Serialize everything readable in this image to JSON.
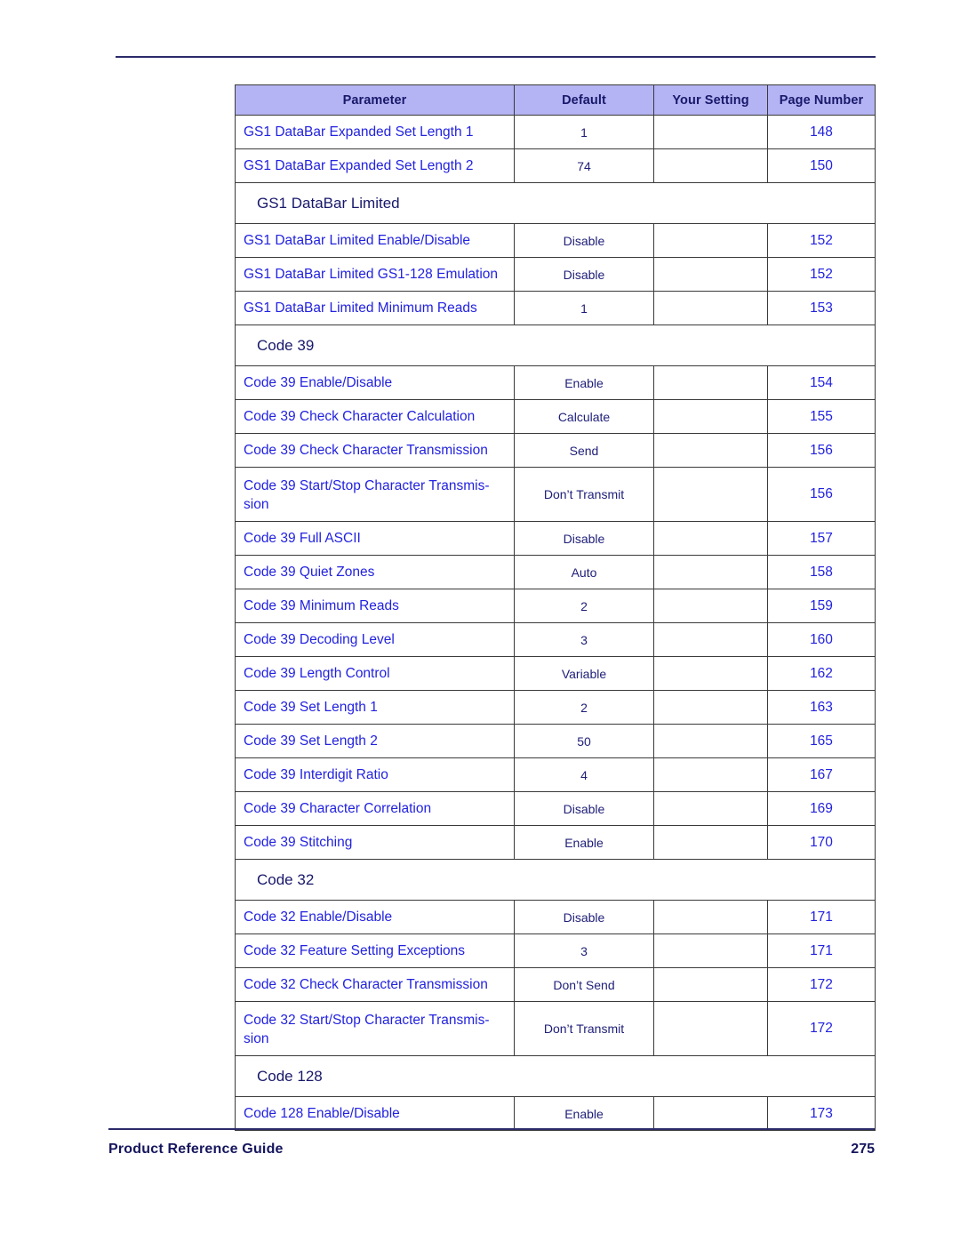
{
  "document": {
    "footer_left": "Product Reference Guide",
    "footer_page_number": "275"
  },
  "table": {
    "columns": [
      "Parameter",
      "Default",
      "Your Setting",
      "Page Number"
    ],
    "rows": [
      {
        "kind": "data",
        "parameter": "GS1 DataBar Expanded Set Length 1",
        "default": "1",
        "setting": "",
        "page": "148"
      },
      {
        "kind": "data",
        "parameter": "GS1 DataBar Expanded Set Length 2",
        "default": "74",
        "setting": "",
        "page": "150"
      },
      {
        "kind": "section",
        "title": "GS1 DataBar Limited"
      },
      {
        "kind": "data",
        "parameter": "GS1 DataBar Limited Enable/Disable",
        "default": "Disable",
        "setting": "",
        "page": "152"
      },
      {
        "kind": "data",
        "parameter": "GS1 DataBar Limited GS1-128 Emulation",
        "default": "Disable",
        "setting": "",
        "page": "152"
      },
      {
        "kind": "data",
        "parameter": "GS1 DataBar Limited Minimum Reads",
        "default": "1",
        "setting": "",
        "page": "153"
      },
      {
        "kind": "section",
        "title": "Code 39"
      },
      {
        "kind": "data",
        "parameter": "Code 39 Enable/Disable",
        "default": "Enable",
        "setting": "",
        "page": "154"
      },
      {
        "kind": "data",
        "parameter": "Code 39 Check Character Calculation",
        "default": "Calculate",
        "setting": "",
        "page": "155"
      },
      {
        "kind": "data",
        "parameter": "Code 39 Check Character Transmission",
        "default": "Send",
        "setting": "",
        "page": "156"
      },
      {
        "kind": "data",
        "two_line": true,
        "parameter": "Code 39 Start/Stop Character Transmis-\nsion",
        "default": "Don’t Transmit",
        "setting": "",
        "page": "156"
      },
      {
        "kind": "data",
        "parameter": "Code 39 Full ASCII",
        "default": "Disable",
        "setting": "",
        "page": "157"
      },
      {
        "kind": "data",
        "parameter": "Code 39 Quiet Zones",
        "default": "Auto",
        "setting": "",
        "page": "158"
      },
      {
        "kind": "data",
        "parameter": "Code 39 Minimum Reads",
        "default": "2",
        "setting": "",
        "page": "159"
      },
      {
        "kind": "data",
        "parameter": "Code 39 Decoding Level",
        "default": "3",
        "setting": "",
        "page": "160"
      },
      {
        "kind": "data",
        "parameter": "Code 39 Length Control",
        "default": "Variable",
        "setting": "",
        "page": "162"
      },
      {
        "kind": "data",
        "parameter": "Code 39 Set Length 1",
        "default": "2",
        "setting": "",
        "page": "163"
      },
      {
        "kind": "data",
        "parameter": "Code 39 Set Length 2",
        "default": "50",
        "setting": "",
        "page": "165"
      },
      {
        "kind": "data",
        "parameter": "Code 39 Interdigit Ratio",
        "default": "4",
        "setting": "",
        "page": "167"
      },
      {
        "kind": "data",
        "parameter": "Code 39 Character Correlation",
        "default": "Disable",
        "setting": "",
        "page": "169"
      },
      {
        "kind": "data",
        "parameter": "Code 39 Stitching",
        "default": "Enable",
        "setting": "",
        "page": "170"
      },
      {
        "kind": "section",
        "title": "Code 32"
      },
      {
        "kind": "data",
        "parameter": "Code 32 Enable/Disable",
        "default": "Disable",
        "setting": "",
        "page": "171"
      },
      {
        "kind": "data",
        "parameter": "Code 32 Feature Setting Exceptions",
        "default": "3",
        "setting": "",
        "page": "171"
      },
      {
        "kind": "data",
        "parameter": "Code 32 Check Character Transmission",
        "default": "Don’t Send",
        "setting": "",
        "page": "172"
      },
      {
        "kind": "data",
        "two_line": true,
        "parameter": "Code 32 Start/Stop Character Transmis-\nsion",
        "default": "Don’t Transmit",
        "setting": "",
        "page": "172"
      },
      {
        "kind": "section",
        "title": "Code 128"
      },
      {
        "kind": "data",
        "parameter": "Code 128 Enable/Disable",
        "default": "Enable",
        "setting": "",
        "page": "173"
      }
    ]
  },
  "colors": {
    "header_fill": "#b4b4f4",
    "header_text": "#18186b",
    "link_blue": "#2222e0",
    "navy": "#18186b",
    "rule": "#2b2b6b"
  }
}
